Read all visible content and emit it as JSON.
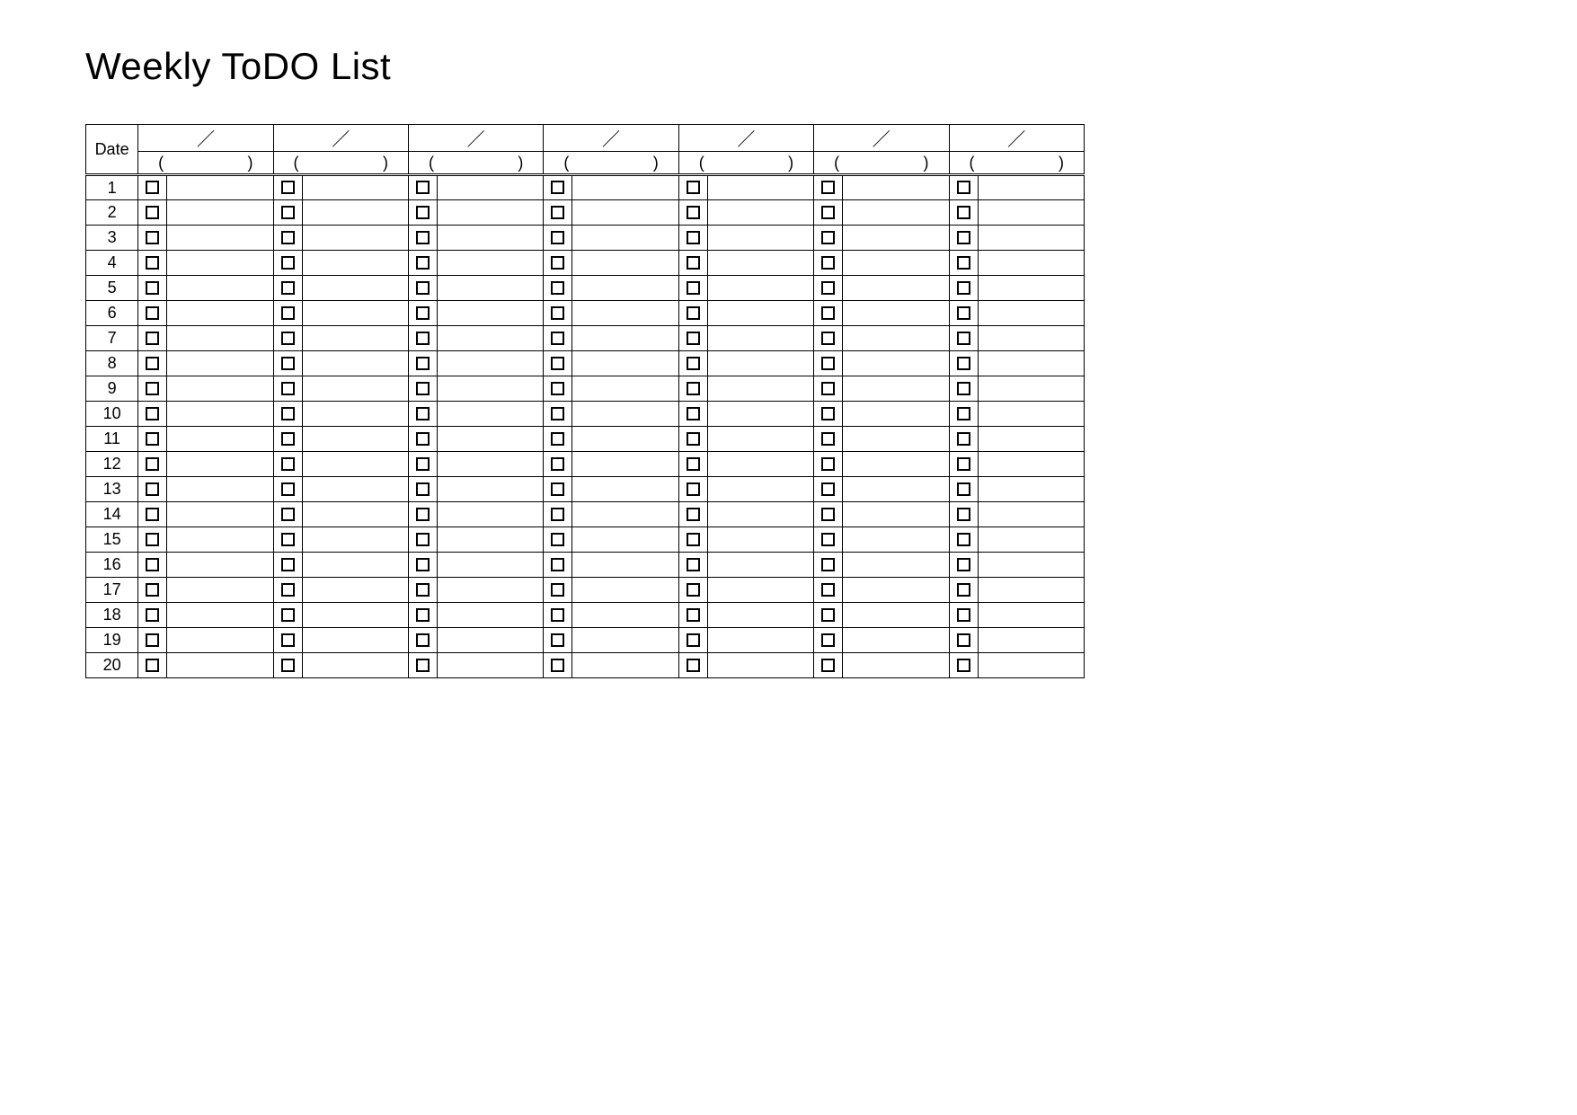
{
  "title": "Weekly ToDO List",
  "header": {
    "date_label": "Date",
    "top_marker": "／",
    "paren_open": "(",
    "paren_close": ")"
  },
  "days": 7,
  "rows": [
    "1",
    "2",
    "3",
    "4",
    "5",
    "6",
    "7",
    "8",
    "9",
    "10",
    "11",
    "12",
    "13",
    "14",
    "15",
    "16",
    "17",
    "18",
    "19",
    "20"
  ]
}
